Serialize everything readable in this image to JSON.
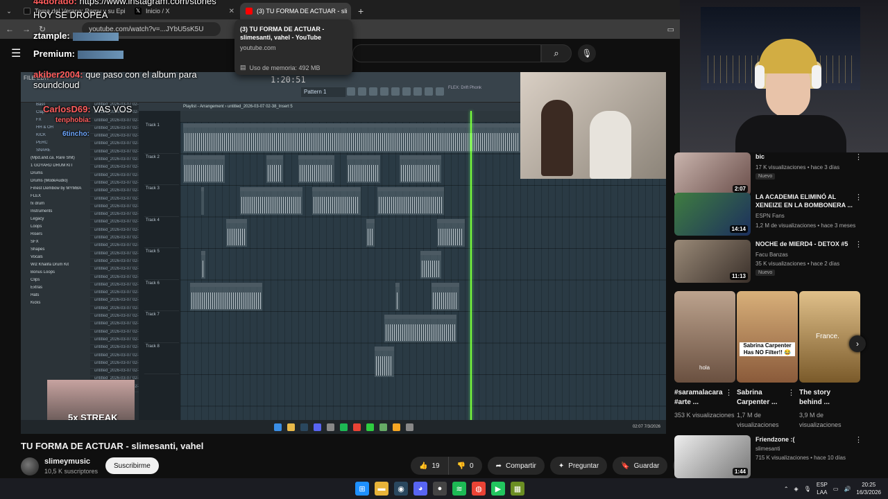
{
  "browser": {
    "tabs": [
      {
        "label": "Tema del Verano: Remy y su Epi",
        "color": "#000000",
        "active": false
      },
      {
        "label": "Inicio / X",
        "color": "#000000",
        "active": false
      },
      {
        "label": "(3) TU FORMA DE ACTUAR - sli",
        "color": "#ff0000",
        "active": true
      }
    ],
    "omnibox_text": "youtube.com/watch?v=...JYbU5sK5U",
    "hovercard": {
      "title": "(3) TU FORMA DE ACTUAR - slimesanti, vahel - YouTube",
      "url": "youtube.com",
      "memory": "Uso de memoria: 492 MB"
    }
  },
  "youtube": {
    "search_placeholder": "",
    "video": {
      "title": "TU FORMA DE ACTUAR - slimesanti, vahel",
      "channel": "slimeymusic",
      "subscribers": "10,5 K suscriptores",
      "subscribe_label": "Suscribirme",
      "likes": "19",
      "dislikes": "0",
      "share_label": "Compartir",
      "ask_label": "Preguntar",
      "save_label": "Guardar"
    },
    "recommendations": [
      {
        "title": "bic",
        "channel": "",
        "meta": "17 K visualizaciones • hace 3 días",
        "badge": "Nuevo",
        "duration": "2:07",
        "thumb": "#b9a7a0"
      },
      {
        "title": "LA ACADEMIA ELIMINÓ AL XENEIZE EN LA BOMBONERA ...",
        "channel": "ESPN Fans",
        "meta": "1,2 M de visualizaciones • hace 3 meses",
        "badge": "",
        "duration": "14:14",
        "thumb": "#3c6b3e"
      },
      {
        "title": "NOCHE de MIERD4 - DETOX #5",
        "channel": "Facu Banzas",
        "meta": "35 K visualizaciones • hace 2 días",
        "badge": "Nuevo",
        "duration": "11:13",
        "thumb": "#8a7a6a"
      },
      {
        "title": "Friendzone :(",
        "channel": "slimesanti",
        "meta": "715 K visualizaciones • hace 10 días",
        "badge": "",
        "duration": "1:44",
        "thumb": "#d7d7d7"
      }
    ],
    "shorts": [
      {
        "title": "#saramalacara #arte ...",
        "views": "353 K visualizaciones",
        "overlay": "hola",
        "thumb": "#a58c7a"
      },
      {
        "title": "Sabrina Carpenter ...",
        "views": "1,7 M de visualizaciones",
        "overlay": "Sabrina Carpenter Has NO Filter!! 😂",
        "thumb": "#c9a77c"
      },
      {
        "title": "The story behind ...",
        "views": "3,9 M de visualizaciones",
        "overlay": "France.",
        "thumb": "#b98e5a"
      }
    ]
  },
  "stream_chat": [
    {
      "name": "44dorado:",
      "message": "https://www.instagram.com/stories"
    },
    {
      "name": "",
      "message": "HOY SE DROPEA"
    },
    {
      "name": "ztample:",
      "message": ""
    },
    {
      "name": "Premium:",
      "message": ""
    },
    {
      "name": "akiber2004:",
      "message": "que paso con el album para soundcloud"
    },
    {
      "name": "CarlosD69:",
      "message": "VAS VOS"
    },
    {
      "name": "tenphobia:",
      "message": ""
    },
    {
      "name": "6tincho:",
      "message": ""
    },
    {
      "name": "ztample:",
      "message": ""
    }
  ],
  "daw": {
    "time": "1:20:51",
    "pattern": "Pattern 1",
    "playlist_title": "Playlist - Arrangement › untitled_2026-03-07 02-38_Insert 5",
    "plugin": "FLEX: Drift Phonk",
    "tracks": [
      "Track 1",
      "Track 2",
      "Track 3",
      "Track 4",
      "Track 5",
      "Track 6",
      "Track 7",
      "Track 8"
    ],
    "browser_items": [
      "Bass",
      "Clap",
      "FX",
      "HH & OH",
      "KICK",
      "PERC",
      "SNARE",
      "(Mpd.and.ca. Rare Shit)",
      "1 GOYARD DRUM KIT",
      "Drums",
      "Drums (ModeAudio)",
      "Finest Dembow by MYMBA",
      "FLEX",
      "fx drum",
      "Instruments",
      "Legacy",
      "Loops",
      "Risers",
      "SFX",
      "Shapes",
      "Vocals",
      "Wiz Khalifa Drum Kit",
      "Bonus Loops",
      "Clips",
      "Extras",
      "Hats",
      "Kicks"
    ],
    "channel_items": [
      "untitled_2026-03-07 02-",
      "untitled_2026-03-07 02-",
      "untitled_2026-03-07 02-",
      "untitled_2026-03-07 02-",
      "untitled_2026-03-07 02-",
      "untitled_2026-03-07 02-",
      "untitled_2026-03-07 02-",
      "untitled_2026-03-07 02-",
      "untitled_2026-03-07 02-",
      "untitled_2026-03-07 02-",
      "untitled_2026-03-07 02-",
      "untitled_2026-03-07 02-",
      "untitled_2026-03-07 02-",
      "untitled_2026-03-07 02-",
      "untitled_2026-03-07 02-",
      "untitled_2026-03-07 02-",
      "untitled_2026-03-07 02-",
      "untitled_2026-03-07 02-",
      "untitled_2026-03-07 02-",
      "untitled_2026-03-07 02-",
      "untitled_2026-03-07 02-",
      "untitled_2026-03-07 02-",
      "untitled_2026-03-07 02-",
      "untitled_2026-03-07 02-",
      "untitled_2026-03-07 02-",
      "untitled_2026-03-07 02-",
      "untitled_2026-03-07 02-",
      "untitled_2026-03-07 02-",
      "untitled_2026-03-07 02-",
      "untitled_2026-03-07 02-",
      "untitled_2026-03-07 02-",
      "untitled_2026-03-07 02-",
      "untitled_2026-03-07 02-",
      "untitled_2026-03-07 02-",
      "untitled_2026-03-07 02-",
      "untitled_2026-03-07 02-",
      "untitled_2026-03-07 02-"
    ],
    "inner_clock": "02:07 7/3/2026",
    "streak_label": "5x STREAK"
  },
  "taskbar": {
    "lang_line1": "ESP",
    "lang_line2": "LAA",
    "time": "20:25",
    "date": "16/3/2026"
  }
}
